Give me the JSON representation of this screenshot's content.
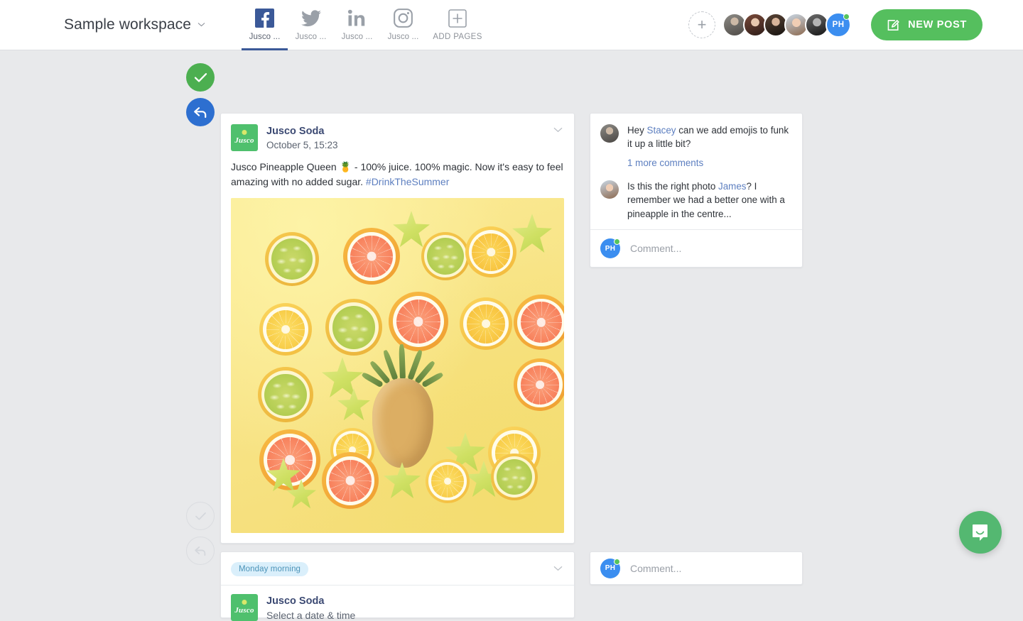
{
  "header": {
    "workspace_name": "Sample workspace",
    "workspace_caret": "chevron-down",
    "pages": [
      {
        "label": "Jusco ...",
        "network": "facebook",
        "active": true
      },
      {
        "label": "Jusco ...",
        "network": "twitter",
        "active": false
      },
      {
        "label": "Jusco ...",
        "network": "linkedin",
        "active": false
      },
      {
        "label": "Jusco ...",
        "network": "instagram",
        "active": false
      },
      {
        "label": "ADD PAGES",
        "network": "plus",
        "active": false
      }
    ],
    "add_member_label": "+",
    "current_user_initials": "PH",
    "new_post_label": "NEW POST",
    "accent_green": "#55bf5e",
    "facebook_blue": "#3b5998",
    "avatar_blue": "#3b8ef0",
    "online_green": "#56c45c"
  },
  "post": {
    "approve_icon": "check-icon",
    "reply_icon": "reply-icon",
    "brand_name": "Jusco Soda",
    "brand_logo_text": "Jusco",
    "date": "October 5,  15:23",
    "menu_icon": "chevron-down-icon",
    "body_pre": "Jusco Pineapple Queen ",
    "body_emoji": "🍍",
    "body_mid": " - 100% juice. 100% magic. Now it's easy to feel amazing with no added sugar. ",
    "hashtag": "#DrinkTheSummer",
    "image_alt": "citrus slices and pineapple on yellow background"
  },
  "comments": {
    "items": [
      {
        "pre": "Hey ",
        "mention": "Stacey",
        "post": " can we add emojis to funk it up a little bit?"
      },
      {
        "pre": "Is this the right photo ",
        "mention": "James",
        "post": "? I remember we had a better one with a pineapple in the centre..."
      }
    ],
    "more_label": "1 more comments",
    "composer_placeholder": "Comment...",
    "composer_initials": "PH"
  },
  "draft": {
    "schedule_badge": "Monday morning",
    "menu_icon": "chevron-down-icon",
    "brand_name": "Jusco Soda",
    "brand_logo_text": "Jusco",
    "subtitle": "Select a date & time",
    "approve_icon": "check-icon",
    "reply_icon": "reply-icon",
    "composer_placeholder": "Comment...",
    "composer_initials": "PH"
  },
  "support": {
    "launcher_icon": "chat-bubble-icon",
    "color": "#54b871"
  }
}
